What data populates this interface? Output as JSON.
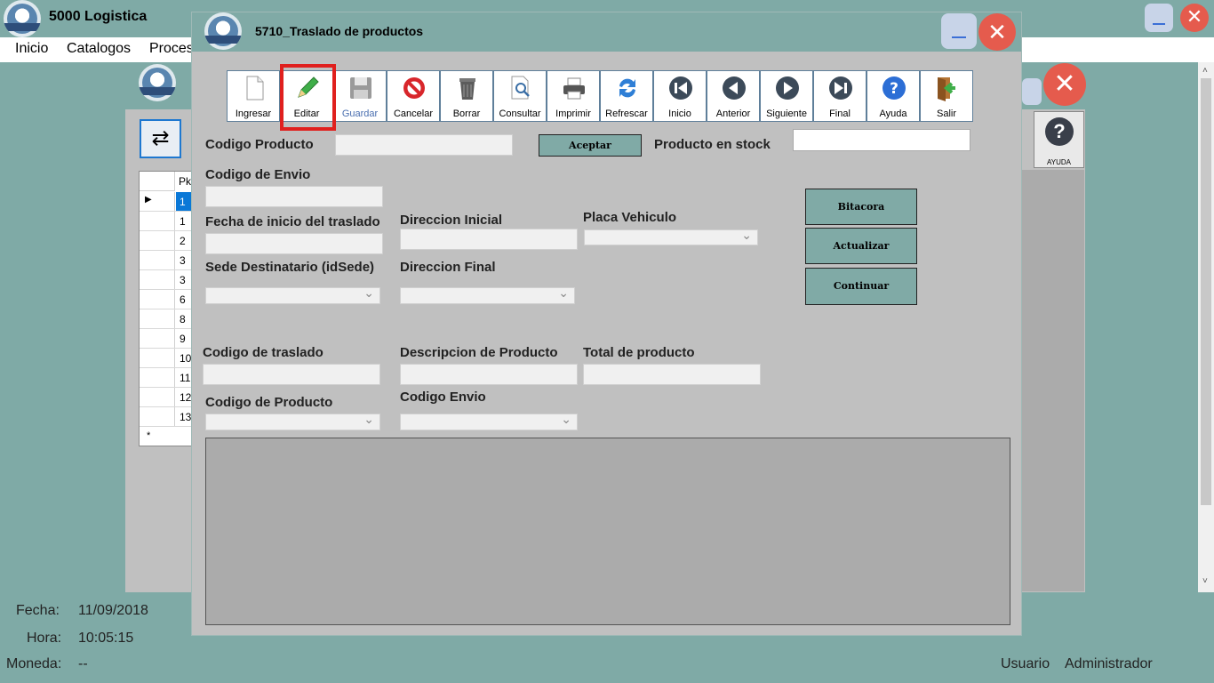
{
  "app": {
    "title": "5000 Logistica",
    "menu": [
      "Inicio",
      "Catalogos",
      "Proces"
    ]
  },
  "status": {
    "fecha_label": "Fecha:",
    "fecha_value": "11/09/2018",
    "hora_label": "Hora:",
    "hora_value": "10:05:15",
    "moneda_label": "Moneda:",
    "moneda_value": "--",
    "usuario_label": "Usuario",
    "usuario_value": "Administrador"
  },
  "back_window": {
    "ayuda_label": "AYUDA",
    "grid": {
      "header": "Pk",
      "rows": [
        "1",
        "1",
        "2",
        "3",
        "3",
        "6",
        "8",
        "9",
        "10",
        "11",
        "12",
        "13"
      ],
      "new_row_marker": "*"
    }
  },
  "dialog": {
    "title": "5710_Traslado de productos",
    "toolbar": [
      {
        "label": "Ingresar",
        "icon": "document-icon"
      },
      {
        "label": "Editar",
        "icon": "pencil-icon"
      },
      {
        "label": "Guardar",
        "icon": "floppy-icon"
      },
      {
        "label": "Cancelar",
        "icon": "cancel-icon"
      },
      {
        "label": "Borrar",
        "icon": "trash-icon"
      },
      {
        "label": "Consultar",
        "icon": "search-document-icon"
      },
      {
        "label": "Imprimir",
        "icon": "printer-icon"
      },
      {
        "label": "Refrescar",
        "icon": "refresh-icon"
      },
      {
        "label": "Inicio",
        "icon": "first-icon"
      },
      {
        "label": "Anterior",
        "icon": "previous-icon"
      },
      {
        "label": "Siguiente",
        "icon": "next-icon"
      },
      {
        "label": "Final",
        "icon": "last-icon"
      },
      {
        "label": "Ayuda",
        "icon": "help-icon"
      },
      {
        "label": "Salir",
        "icon": "exit-icon"
      }
    ],
    "labels": {
      "codigo_producto": "Codigo Producto",
      "producto_stock": "Producto en stock",
      "codigo_envio": "Codigo de Envio",
      "fecha_inicio": "Fecha de inicio del traslado",
      "direccion_inicial": "Direccion Inicial",
      "placa": "Placa Vehiculo",
      "sede": "Sede Destinatario (idSede)",
      "direccion_final": "Direccion Final",
      "codigo_traslado": "Codigo de traslado",
      "descripcion": "Descripcion de Producto",
      "total": "Total de producto",
      "codigo_de_producto": "Codigo de Producto",
      "codigo_envio2": "Codigo Envio"
    },
    "buttons": {
      "aceptar": "Aceptar",
      "bitacora": "Bitacora",
      "actualizar": "Actualizar",
      "continuar": "Continuar"
    },
    "highlight_color": "#e0201e"
  }
}
